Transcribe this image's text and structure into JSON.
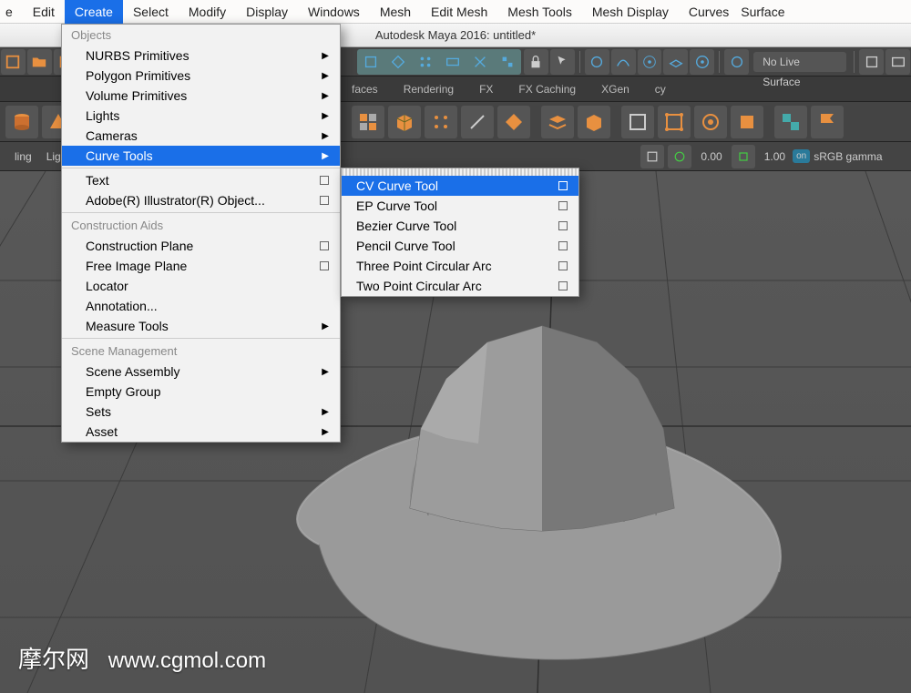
{
  "menubar": {
    "items": [
      {
        "label": "e",
        "partial": true
      },
      {
        "label": "Edit"
      },
      {
        "label": "Create",
        "active": true
      },
      {
        "label": "Select"
      },
      {
        "label": "Modify"
      },
      {
        "label": "Display"
      },
      {
        "label": "Windows"
      },
      {
        "label": "Mesh"
      },
      {
        "label": "Edit Mesh"
      },
      {
        "label": "Mesh Tools"
      },
      {
        "label": "Mesh Display"
      },
      {
        "label": "Curves"
      },
      {
        "label": "Surface",
        "partial": true
      }
    ]
  },
  "titlebar": "Autodesk Maya 2016: untitled*",
  "toolbar": {
    "no_live": "No Live Surface"
  },
  "shelf_tabs": [
    {
      "label": "faces",
      "partial": true
    },
    {
      "label": "Rendering"
    },
    {
      "label": "FX"
    },
    {
      "label": "FX Caching"
    },
    {
      "label": "XGen"
    },
    {
      "label": "cy"
    }
  ],
  "statusbar": {
    "left_items": [
      "ling",
      "Ligh"
    ],
    "exposure": "0.00",
    "gamma": "1.00",
    "colorspace": "sRGB gamma"
  },
  "create_menu": {
    "sections": [
      {
        "header": "Objects",
        "items": [
          {
            "label": "NURBS Primitives",
            "arrow": true
          },
          {
            "label": "Polygon Primitives",
            "arrow": true
          },
          {
            "label": "Volume Primitives",
            "arrow": true
          },
          {
            "label": "Lights",
            "arrow": true
          },
          {
            "label": "Cameras",
            "arrow": true
          },
          {
            "label": "Curve Tools",
            "arrow": true,
            "hi": true
          }
        ]
      },
      {
        "items": [
          {
            "label": "Text",
            "box": true
          },
          {
            "label": "Adobe(R) Illustrator(R) Object...",
            "box": true
          }
        ]
      },
      {
        "header": "Construction Aids",
        "items": [
          {
            "label": "Construction Plane",
            "box": true
          },
          {
            "label": "Free Image Plane",
            "box": true
          },
          {
            "label": "Locator"
          },
          {
            "label": "Annotation..."
          },
          {
            "label": "Measure Tools",
            "arrow": true
          }
        ]
      },
      {
        "header": "Scene Management",
        "items": [
          {
            "label": "Scene Assembly",
            "arrow": true
          },
          {
            "label": "Empty Group"
          },
          {
            "label": "Sets",
            "arrow": true
          },
          {
            "label": "Asset",
            "arrow": true
          }
        ]
      }
    ]
  },
  "curve_submenu": {
    "items": [
      {
        "label": "CV Curve Tool",
        "box": true,
        "hi": true
      },
      {
        "label": "EP Curve Tool",
        "box": true
      },
      {
        "label": "Bezier Curve Tool",
        "box": true
      },
      {
        "label": "Pencil Curve Tool",
        "box": true
      },
      {
        "label": "Three Point Circular Arc",
        "box": true
      },
      {
        "label": "Two Point Circular Arc",
        "box": true
      }
    ]
  },
  "watermark": {
    "cn": "摩尔网",
    "url": "www.cgmol.com"
  }
}
